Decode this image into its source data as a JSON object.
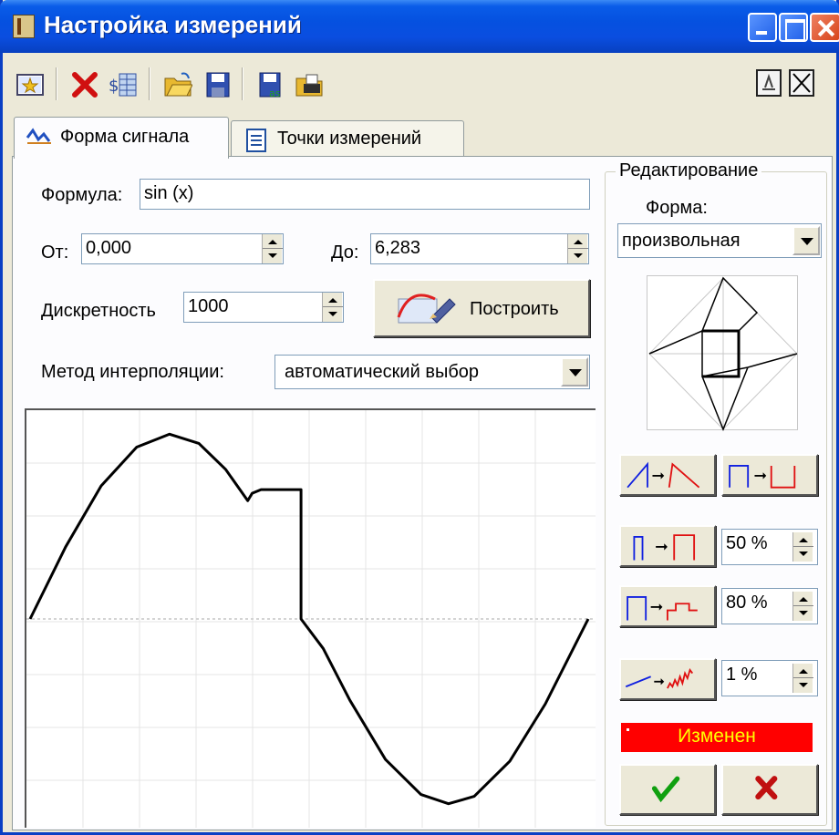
{
  "window": {
    "title": "Настройка измерений"
  },
  "toolbar": {
    "tools": [
      "new-icon",
      "delete-icon",
      "table-icon",
      "open-icon",
      "save-icon",
      "save-as-icon",
      "print-icon"
    ],
    "right_buttons": [
      "dock-icon",
      "close-icon"
    ]
  },
  "tabs": [
    {
      "label": "Форма сигнала",
      "icon": "signal-icon",
      "active": true
    },
    {
      "label": "Точки измерений",
      "icon": "list-icon",
      "active": false
    }
  ],
  "form": {
    "formula_label": "Формула:",
    "formula_value": "sin (x)",
    "from_label": "От:",
    "from_value": "0,000",
    "to_label": "До:",
    "to_value": "6,283",
    "step_label": "Дискретность",
    "step_value": "1000",
    "build_button": "Построить",
    "interp_label": "Метод интерполяции:",
    "interp_value": "автоматический выбор"
  },
  "edit": {
    "group_title": "Редактирование",
    "shape_label": "Форма:",
    "shape_value": "произвольная",
    "duty1": "50 %",
    "duty2": "80 %",
    "noise": "1 %",
    "status": "Изменен",
    "ok_icon": "check-icon",
    "cancel_icon": "cross-icon"
  },
  "chart_data": {
    "type": "line",
    "title": "",
    "xlabel": "",
    "ylabel": "",
    "xlim": [
      0,
      6.283
    ],
    "ylim": [
      -1.1,
      1.1
    ],
    "grid": true,
    "series": [
      {
        "x": [
          0,
          0.4,
          0.8,
          1.2,
          1.57,
          1.9,
          2.2,
          2.45,
          2.5,
          2.6,
          2.9,
          3.05,
          3.05,
          3.3,
          3.6,
          4.0,
          4.4,
          4.71,
          5.0,
          5.4,
          5.8,
          6.283
        ],
        "y": [
          0,
          0.39,
          0.72,
          0.93,
          1.0,
          0.95,
          0.81,
          0.64,
          0.68,
          0.7,
          0.7,
          0.7,
          0.0,
          -0.16,
          -0.44,
          -0.76,
          -0.95,
          -1.0,
          -0.96,
          -0.77,
          -0.46,
          0
        ]
      }
    ]
  }
}
